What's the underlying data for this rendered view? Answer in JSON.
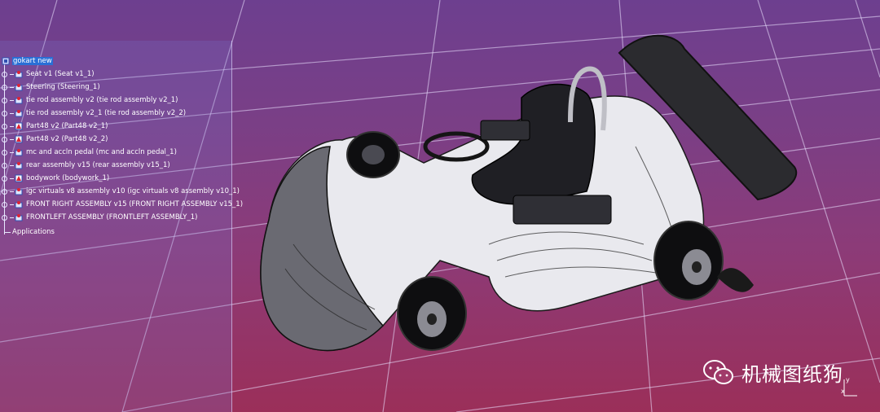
{
  "tree": {
    "root": "gokart new",
    "items": [
      "Seat v1 (Seat v1_1)",
      "Steering (Steering_1)",
      "tie rod assembly v2 (tie rod assembly v2_1)",
      "tie rod assembly v2_1 (tie rod assembly v2_2)",
      "Part48 v2 (Part48 v2_1)",
      "Part48 v2 (Part48 v2_2)",
      "mc and accln pedal (mc and accln pedal_1)",
      "rear assembly v15 (rear assembly v15_1)",
      "bodywork (bodywork_1)",
      "igc virtuals v8 assembly v10 (igc virtuals v8 assembly v10_1)",
      "FRONT RIGHT ASSEMBLY v15 (FRONT RIGHT ASSEMBLY v15_1)",
      "FRONTLEFT ASSEMBLY (FRONTLEFT ASSEMBLY_1)"
    ],
    "applications": "Applications"
  },
  "watermark": {
    "text": "机械图纸狗",
    "icon": "wechat-icon"
  },
  "axis": {
    "y": "y",
    "x": "x",
    "icon": "compass-axis-icon"
  },
  "colors": {
    "selection": "#2a6fd6",
    "background_top": "#6d3f8f",
    "background_bottom": "#9b2f59"
  }
}
